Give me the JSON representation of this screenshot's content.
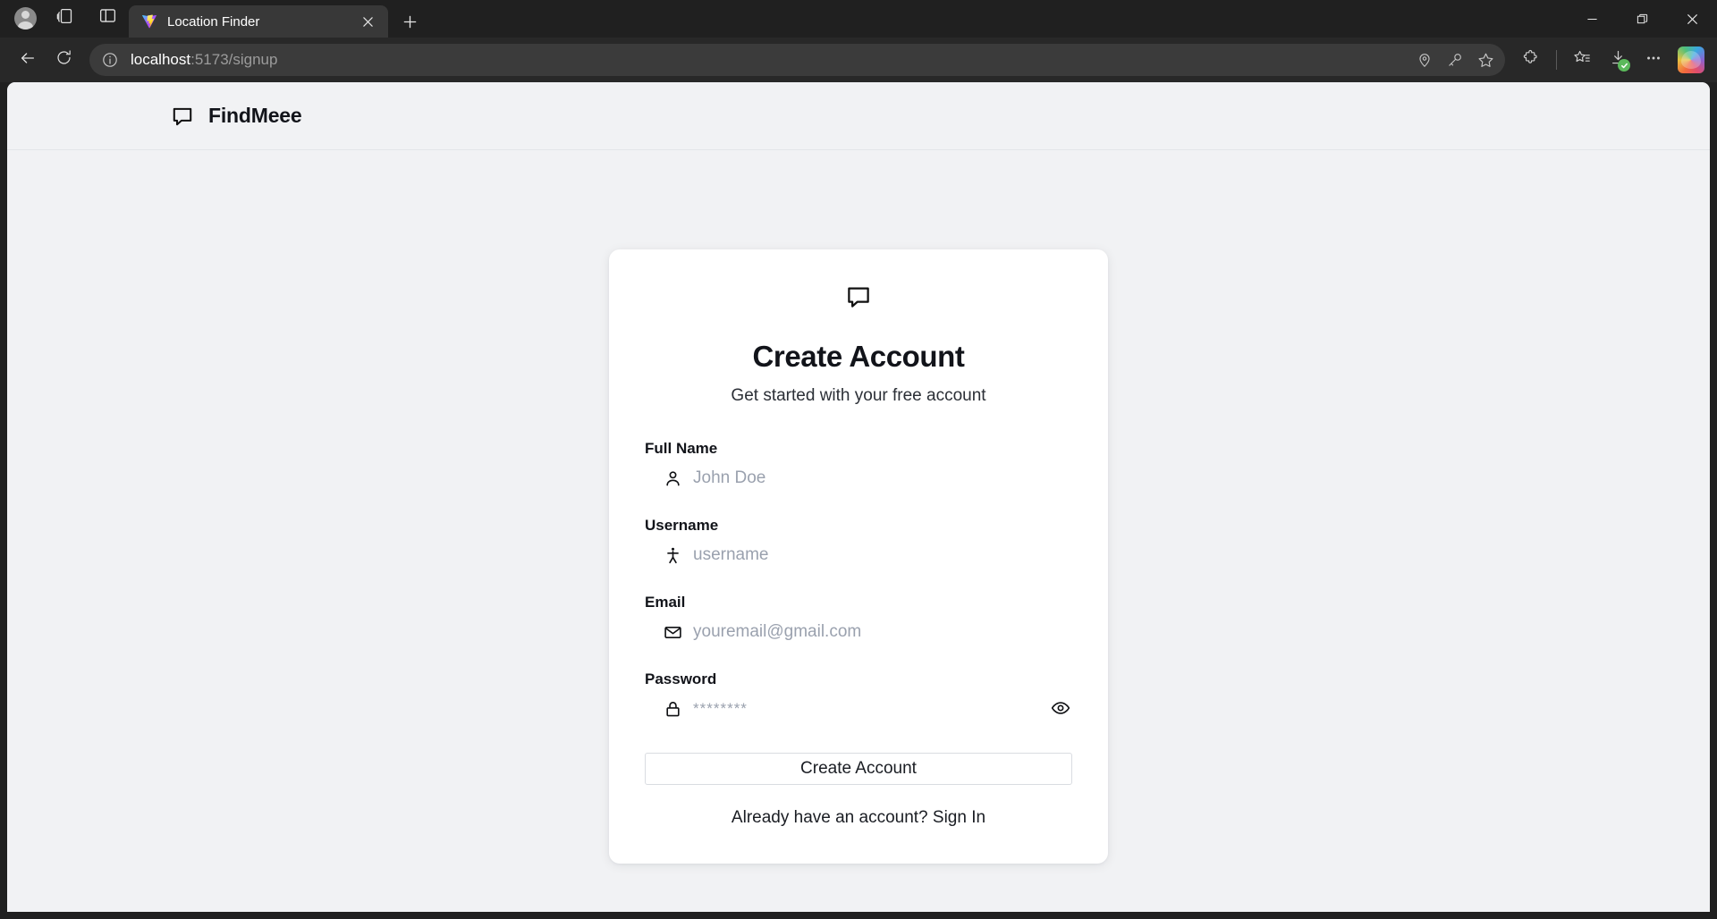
{
  "browser": {
    "tab": {
      "title": "Location Finder",
      "favicon": "vite-lightning-icon",
      "close_label": "×"
    },
    "newtab_label": "+",
    "window_controls": {
      "minimize": "—",
      "restore": "❐",
      "close": "✕"
    },
    "toolbar_icons": {
      "profile": "profile-avatar-icon",
      "workspaces": "workspaces-icon",
      "split_screen": "split-screen-icon",
      "back": "back-arrow-icon",
      "reload": "reload-icon",
      "info": "site-info-icon",
      "location": "location-pin-icon",
      "password": "key-icon",
      "favorite": "star-icon",
      "extensions": "puzzle-piece-icon",
      "collections": "collections-icon",
      "downloads": "download-icon",
      "more": "ellipsis-icon",
      "copilot": "copilot-icon"
    },
    "address": {
      "host": "localhost",
      "path": ":5173/signup"
    }
  },
  "app": {
    "header": {
      "brand": "FindMeee",
      "logo_icon": "chat-bubble-icon"
    },
    "card": {
      "logo_icon": "chat-bubble-icon",
      "title": "Create Account",
      "subtitle": "Get started with your free account",
      "fields": [
        {
          "label": "Full Name",
          "icon": "person-icon",
          "placeholder": "John Doe",
          "value": ""
        },
        {
          "label": "Username",
          "icon": "person-standing-icon",
          "placeholder": "username",
          "value": ""
        },
        {
          "label": "Email",
          "icon": "envelope-icon",
          "placeholder": "youremail@gmail.com",
          "value": ""
        },
        {
          "label": "Password",
          "icon": "lock-icon",
          "placeholder": "********",
          "value": "",
          "toggle_icon": "eye-icon"
        }
      ],
      "submit_label": "Create Account",
      "footer_text": "Already have an account? Sign In"
    }
  },
  "colors": {
    "page_bg": "#f1f2f4",
    "card_bg": "#ffffff",
    "chrome_bg": "#202020",
    "navbar_bg": "#282828",
    "tab_active": "#383838",
    "text_primary": "#12141a",
    "placeholder": "#9aa1ae",
    "download_badge": "#5bb95b"
  }
}
